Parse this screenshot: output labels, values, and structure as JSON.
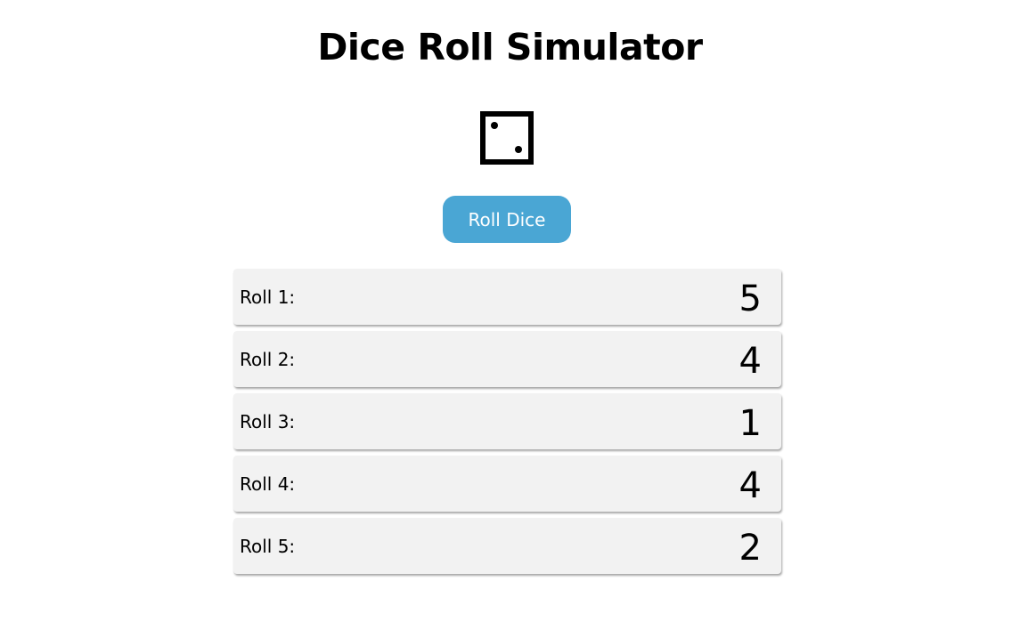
{
  "page": {
    "title": "Dice Roll Simulator"
  },
  "die": {
    "icon": "die-face-two-icon",
    "face": 2
  },
  "controls": {
    "roll_button_label": "Roll Dice",
    "accent_color": "#4aa6d4"
  },
  "results": [
    {
      "label": "Roll 1:",
      "value": "5"
    },
    {
      "label": "Roll 2:",
      "value": "4"
    },
    {
      "label": "Roll 3:",
      "value": "1"
    },
    {
      "label": "Roll 4:",
      "value": "4"
    },
    {
      "label": "Roll 5:",
      "value": "2"
    }
  ]
}
